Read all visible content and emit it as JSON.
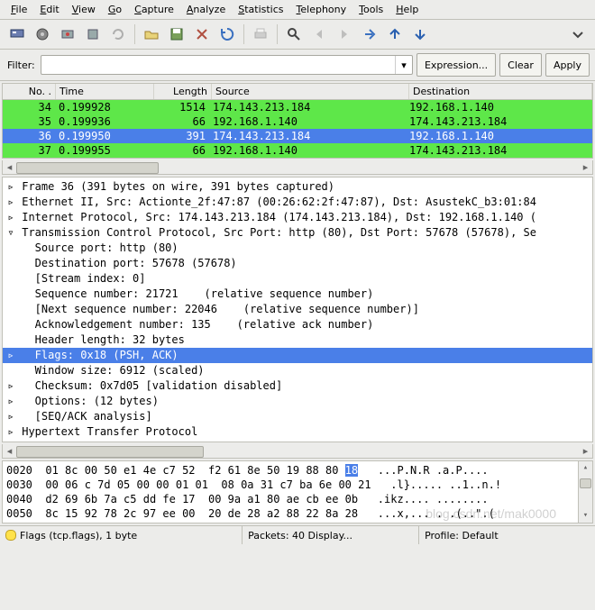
{
  "menu": [
    "File",
    "Edit",
    "View",
    "Go",
    "Capture",
    "Analyze",
    "Statistics",
    "Telephony",
    "Tools",
    "Help"
  ],
  "filter": {
    "label": "Filter:",
    "value": "",
    "expression": "Expression...",
    "clear": "Clear",
    "apply": "Apply"
  },
  "columns": {
    "no": "No. .",
    "time": "Time",
    "len": "Length",
    "src": "Source",
    "dst": "Destination"
  },
  "packets": [
    {
      "no": "34",
      "time": "0.199928",
      "len": "1514",
      "src": "174.143.213.184",
      "dst": "192.168.1.140",
      "cls": "row-green"
    },
    {
      "no": "35",
      "time": "0.199936",
      "len": "66",
      "src": "192.168.1.140",
      "dst": "174.143.213.184",
      "cls": "row-green"
    },
    {
      "no": "36",
      "time": "0.199950",
      "len": "391",
      "src": "174.143.213.184",
      "dst": "192.168.1.140",
      "cls": "row-blue"
    },
    {
      "no": "37",
      "time": "0.199955",
      "len": "66",
      "src": "192.168.1.140",
      "dst": "174.143.213.184",
      "cls": "row-green"
    }
  ],
  "tree": [
    {
      "t": "▹",
      "i": 0,
      "txt": "Frame 36 (391 bytes on wire, 391 bytes captured)"
    },
    {
      "t": "▹",
      "i": 0,
      "txt": "Ethernet II, Src: Actionte_2f:47:87 (00:26:62:2f:47:87), Dst: AsustekC_b3:01:84"
    },
    {
      "t": "▹",
      "i": 0,
      "txt": "Internet Protocol, Src: 174.143.213.184 (174.143.213.184), Dst: 192.168.1.140 ("
    },
    {
      "t": "▿",
      "i": 0,
      "txt": "Transmission Control Protocol, Src Port: http (80), Dst Port: 57678 (57678), Se"
    },
    {
      "t": " ",
      "i": 1,
      "txt": "Source port: http (80)"
    },
    {
      "t": " ",
      "i": 1,
      "txt": "Destination port: 57678 (57678)"
    },
    {
      "t": " ",
      "i": 1,
      "txt": "[Stream index: 0]"
    },
    {
      "t": " ",
      "i": 1,
      "txt": "Sequence number: 21721    (relative sequence number)"
    },
    {
      "t": " ",
      "i": 1,
      "txt": "[Next sequence number: 22046    (relative sequence number)]"
    },
    {
      "t": " ",
      "i": 1,
      "txt": "Acknowledgement number: 135    (relative ack number)"
    },
    {
      "t": " ",
      "i": 1,
      "txt": "Header length: 32 bytes"
    },
    {
      "t": "▹",
      "i": 1,
      "txt": "Flags: 0x18 (PSH, ACK)",
      "sel": true
    },
    {
      "t": " ",
      "i": 1,
      "txt": "Window size: 6912 (scaled)"
    },
    {
      "t": "▹",
      "i": 1,
      "txt": "Checksum: 0x7d05 [validation disabled]"
    },
    {
      "t": "▹",
      "i": 1,
      "txt": "Options: (12 bytes)"
    },
    {
      "t": "▹",
      "i": 1,
      "txt": "[SEQ/ACK analysis]"
    },
    {
      "t": "▹",
      "i": 0,
      "txt": "Hypertext Transfer Protocol"
    }
  ],
  "hex": [
    {
      "off": "0020",
      "b": "01 8c 00 50 e1 4e c7 52  f2 61 8e 50 19 88 80 ",
      "hi": "18",
      "a": "   ...P.N.R .a.P...."
    },
    {
      "off": "0030",
      "b": "00 06 c 7d 05 00 00 01 01  08 0a 31 c7 ba 6e 00 21",
      "a": "   .l}..... ..1..n.!"
    },
    {
      "off": "0040",
      "b": "d2 69 6b 7a c5 dd fe 17  00 9a a1 80 ae cb ee 0b",
      "a": "   .ikz.... ........"
    },
    {
      "off": "0050",
      "b": "8c 15 92 78 2c 97 ee 00  20 de 28 a2 88 22 8a 28",
      "a": "   ...x,... . .(..\".("
    }
  ],
  "status": {
    "flags": "Flags (tcp.flags), 1 byte",
    "pkts": "Packets: 40 Display...",
    "profile": "Profile: Default"
  },
  "watermark": "blog.csdn.net/mak0000"
}
